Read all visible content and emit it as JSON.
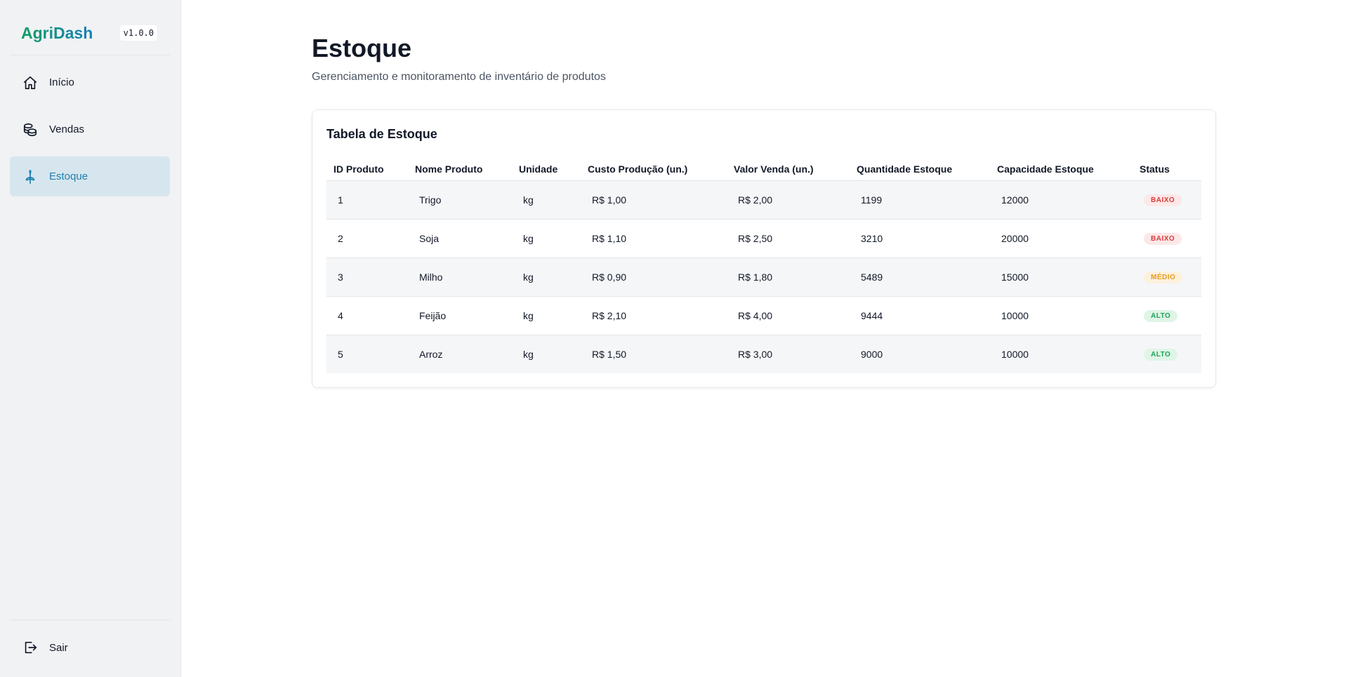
{
  "app": {
    "name": "AgriDash",
    "version": "v1.0.0"
  },
  "sidebar": {
    "items": [
      {
        "label": "Início",
        "icon": "home-icon",
        "active": false
      },
      {
        "label": "Vendas",
        "icon": "coins-icon",
        "active": false
      },
      {
        "label": "Estoque",
        "icon": "sprout-icon",
        "active": true
      }
    ],
    "logout_label": "Sair",
    "logout_icon": "logout-icon"
  },
  "page": {
    "title": "Estoque",
    "subtitle": "Gerenciamento e monitoramento de inventário de produtos"
  },
  "table": {
    "title": "Tabela de Estoque",
    "columns": [
      "ID Produto",
      "Nome Produto",
      "Unidade",
      "Custo Produção (un.)",
      "Valor Venda (un.)",
      "Quantidade Estoque",
      "Capacidade Estoque",
      "Status"
    ],
    "rows": [
      {
        "id": "1",
        "nome": "Trigo",
        "unidade": "kg",
        "custo": "R$ 1,00",
        "valor": "R$ 2,00",
        "quantidade": "1199",
        "capacidade": "12000",
        "status": "BAIXO",
        "status_level": "baixo"
      },
      {
        "id": "2",
        "nome": "Soja",
        "unidade": "kg",
        "custo": "R$ 1,10",
        "valor": "R$ 2,50",
        "quantidade": "3210",
        "capacidade": "20000",
        "status": "BAIXO",
        "status_level": "baixo"
      },
      {
        "id": "3",
        "nome": "Milho",
        "unidade": "kg",
        "custo": "R$ 0,90",
        "valor": "R$ 1,80",
        "quantidade": "5489",
        "capacidade": "15000",
        "status": "MÉDIO",
        "status_level": "medio"
      },
      {
        "id": "4",
        "nome": "Feijão",
        "unidade": "kg",
        "custo": "R$ 2,10",
        "valor": "R$ 4,00",
        "quantidade": "9444",
        "capacidade": "10000",
        "status": "ALTO",
        "status_level": "alto"
      },
      {
        "id": "5",
        "nome": "Arroz",
        "unidade": "kg",
        "custo": "R$ 1,50",
        "valor": "R$ 3,00",
        "quantidade": "9000",
        "capacidade": "10000",
        "status": "ALTO",
        "status_level": "alto"
      }
    ]
  },
  "colors": {
    "brand_green": "#0f9d63",
    "brand_blue": "#1a7fb8",
    "active_bg": "#d7e6ee",
    "active_text": "#1e7fae",
    "status_baixo": "#dc3b3b",
    "status_medio": "#e59b1e",
    "status_alto": "#1fa35a"
  }
}
